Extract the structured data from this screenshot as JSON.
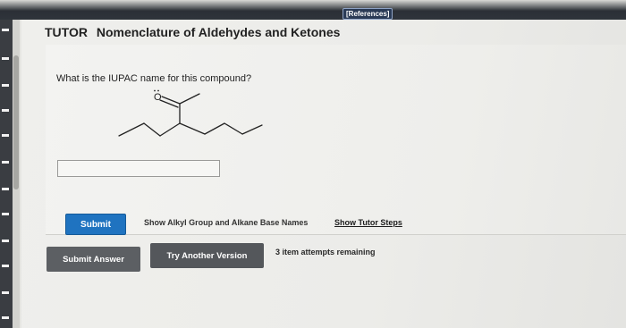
{
  "header": {
    "references_label": "[References]"
  },
  "title": {
    "brand": "TUTOR",
    "text": "Nomenclature of Aldehydes and Ketones"
  },
  "question": {
    "prompt": "What is the IUPAC name for this compound?",
    "oxygen_label": "O",
    "answer_value": ""
  },
  "actions": {
    "submit_label": "Submit",
    "alkyl_link": "Show Alkyl Group and Alkane Base Names",
    "tutor_link": "Show Tutor Steps",
    "submit_answer_label": "Submit Answer",
    "try_another_label": "Try Another Version",
    "attempts_text": "3 item attempts remaining"
  },
  "colors": {
    "submit_button": "#1f73c0",
    "dark_button": "#5c5f63"
  }
}
